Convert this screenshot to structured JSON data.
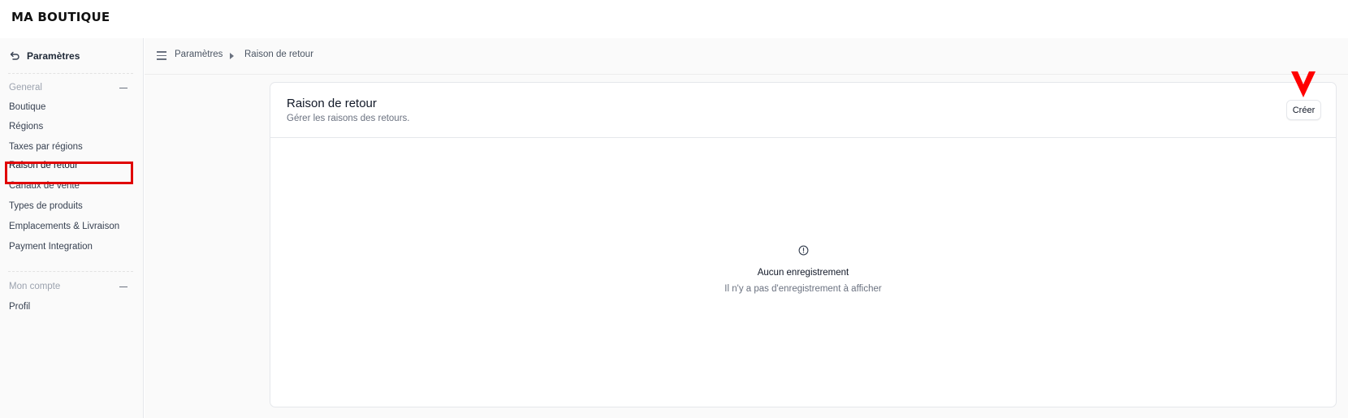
{
  "brand": "MA BOUTIQUE",
  "sidebar": {
    "back_label": "Paramètres",
    "sections": [
      {
        "title": "General",
        "items": [
          "Boutique",
          "Régions",
          "Taxes par régions",
          "Raison de retour",
          "Canaux de vente",
          "Types de produits",
          "Emplacements & Livraison",
          "Payment Integration"
        ]
      },
      {
        "title": "Mon compte",
        "items": [
          "Profil"
        ]
      }
    ],
    "active_item": "Raison de retour"
  },
  "breadcrumb": {
    "parent": "Paramètres",
    "current": "Raison de retour"
  },
  "page": {
    "title": "Raison de retour",
    "subtitle": "Gérer les raisons des retours.",
    "create_label": "Créer"
  },
  "empty_state": {
    "title": "Aucun enregistrement",
    "message": "Il n'y a pas d'enregistrement à afficher"
  },
  "colors": {
    "highlight": "#e00000",
    "annotation_arrow": "#ff0000"
  },
  "icons": {
    "back": "back-arrow-icon",
    "menu": "hamburger-menu-icon",
    "breadcrumb_separator": "triangle-right-icon",
    "section_collapse": "minus-icon",
    "empty": "info-circle-icon"
  }
}
